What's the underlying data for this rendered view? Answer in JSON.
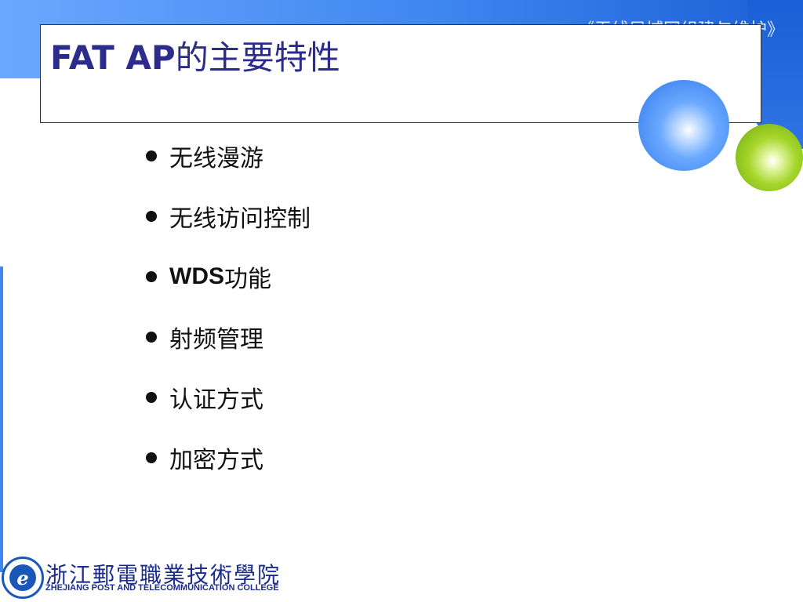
{
  "header": {
    "course_title": "《无线局域网组建与维护》"
  },
  "slide": {
    "title_latin": "FAT AP",
    "title_cn": "的主要特性",
    "bullets": [
      {
        "prefix": "",
        "text": "无线漫游"
      },
      {
        "prefix": "",
        "text": "无线访问控制"
      },
      {
        "prefix": "WDS",
        "text": "功能"
      },
      {
        "prefix": "",
        "text": "射频管理"
      },
      {
        "prefix": "",
        "text": "认证方式"
      },
      {
        "prefix": "",
        "text": "加密方式"
      }
    ]
  },
  "footer": {
    "logo_letter": "e",
    "college_cn": "浙江郵電職業技術學院",
    "college_en": "ZHEJIANG POST AND TELECOMMUNICATION COLLEGE"
  },
  "colors": {
    "title": "#2b2c8c",
    "band_blue": "#3f86f0",
    "ball_green": "#a6d62a",
    "college_text": "#1a2d8a"
  }
}
